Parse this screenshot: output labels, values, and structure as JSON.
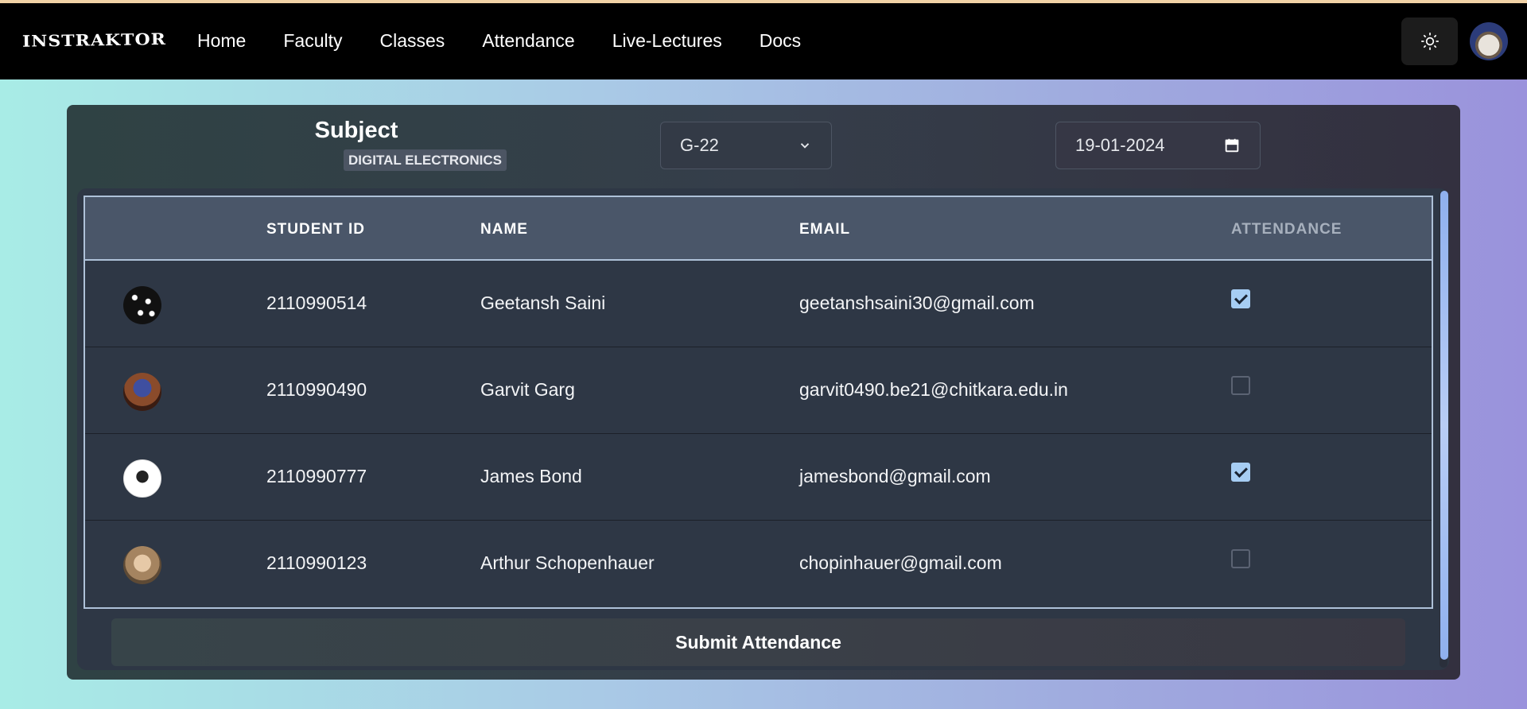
{
  "app": {
    "logo": "INSTRAKTOR"
  },
  "nav": {
    "items": [
      {
        "label": "Home"
      },
      {
        "label": "Faculty"
      },
      {
        "label": "Classes"
      },
      {
        "label": "Attendance"
      },
      {
        "label": "Live-Lectures"
      },
      {
        "label": "Docs"
      }
    ],
    "theme_icon": "sun-icon",
    "avatar_icon": "user-avatar"
  },
  "filters": {
    "subject_label": "Subject",
    "subject_value": "DIGITAL ELECTRONICS",
    "group_value": "G-22",
    "date_value": "19-01-2024"
  },
  "table": {
    "headers": {
      "avatar": "",
      "student_id": "STUDENT ID",
      "name": "NAME",
      "email": "EMAIL",
      "attendance": "ATTENDANCE"
    },
    "rows": [
      {
        "student_id": "2110990514",
        "name": "Geetansh Saini",
        "email": "geetanshsaini30@gmail.com",
        "present": true
      },
      {
        "student_id": "2110990490",
        "name": "Garvit Garg",
        "email": "garvit0490.be21@chitkara.edu.in",
        "present": false
      },
      {
        "student_id": "2110990777",
        "name": "James Bond",
        "email": "jamesbond@gmail.com",
        "present": true
      },
      {
        "student_id": "2110990123",
        "name": "Arthur Schopenhauer",
        "email": "chopinhauer@gmail.com",
        "present": false
      }
    ]
  },
  "actions": {
    "submit_label": "Submit Attendance"
  },
  "colors": {
    "accent_checkbox": "#a6cdf3",
    "navbar": "#000000",
    "header_bg": "#4a5669"
  }
}
